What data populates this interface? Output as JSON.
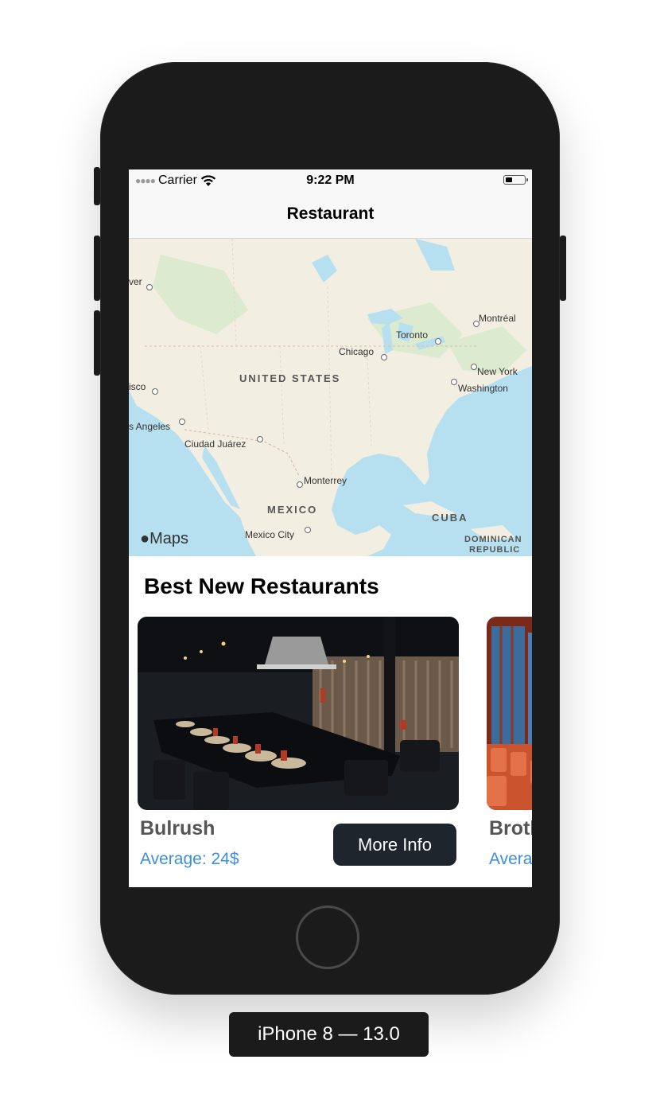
{
  "status_bar": {
    "carrier": "Carrier",
    "time": "9:22 PM",
    "battery_level": 0.4
  },
  "nav": {
    "title": "Restaurant"
  },
  "map": {
    "logo_text": "Maps",
    "countries": [
      "UNITED STATES",
      "MEXICO",
      "CUBA",
      "DOMINICAN",
      "REPUBLIC"
    ],
    "cities": [
      "ver",
      "Montréal",
      "Toronto",
      "Chicago",
      "New York",
      "Washington",
      "isco",
      "s Angeles",
      "Ciudad Juárez",
      "Monterrey",
      "Mexico City"
    ]
  },
  "section_title": "Best New Restaurants",
  "restaurants": [
    {
      "name": "Bulrush",
      "average": "Average: 24$",
      "button_label": "More Info"
    },
    {
      "name": "Broth",
      "average": "Average"
    }
  ],
  "device_label": "iPhone 8 — 13.0",
  "colors": {
    "accent_blue": "#3d8fd9",
    "button_dark": "#1f252d",
    "device_body": "#1b1b1c"
  }
}
